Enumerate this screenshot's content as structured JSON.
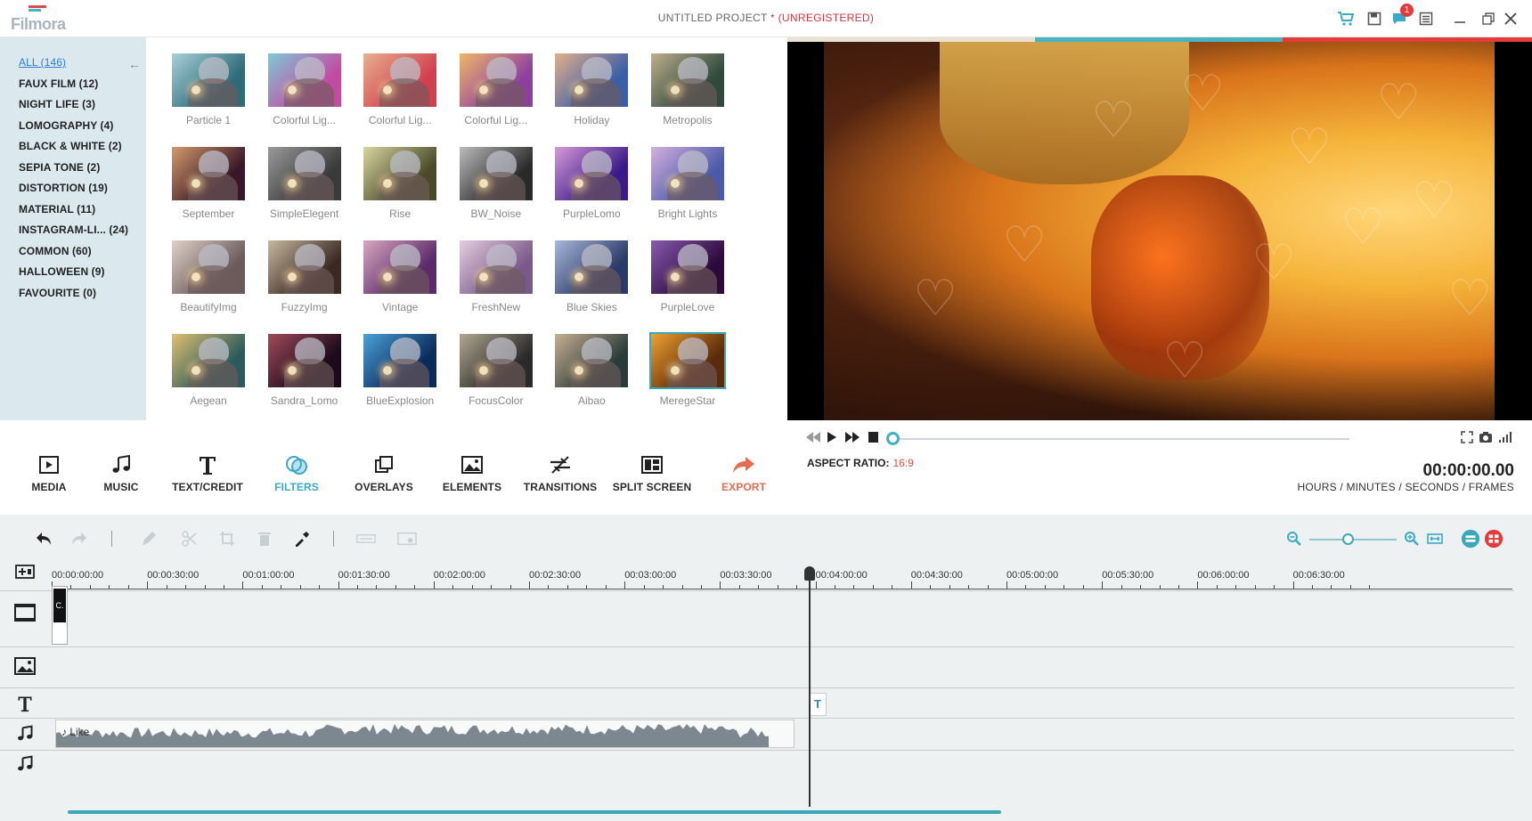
{
  "app": {
    "logo": "Filmora",
    "logo_colors": [
      "#e04b4b",
      "#4ab3c3",
      "#a9b4bd"
    ],
    "title": "UNTITLED PROJECT *",
    "title_status": "(UNREGISTERED)",
    "notifications": "1",
    "icons": [
      "cart-icon",
      "save-icon",
      "chat-icon",
      "menu-icon",
      "minimize-icon",
      "restore-icon",
      "close-icon"
    ]
  },
  "library": {
    "categories": [
      "ALL (146)",
      "FAUX FILM (12)",
      "NIGHT LIFE (3)",
      "LOMOGRAPHY (4)",
      "BLACK & WHITE (2)",
      "SEPIA TONE (2)",
      "DISTORTION (19)",
      "MATERIAL (11)",
      "INSTAGRAM-LI...  (24)",
      "COMMON (60)",
      "HALLOWEEN (9)",
      "FAVOURITE (0)"
    ],
    "active_category": 0,
    "filters": [
      {
        "label": "Particle 1",
        "tint": [
          "#2e6a78",
          "#a7d1d8"
        ]
      },
      {
        "label": "Colorful Lig...",
        "tint": [
          "#c24aa0",
          "#7ec9d8"
        ]
      },
      {
        "label": "Colorful Lig...",
        "tint": [
          "#d23f4f",
          "#e7b08f"
        ]
      },
      {
        "label": "Colorful Lig...",
        "tint": [
          "#8e3f9f",
          "#f0b766"
        ]
      },
      {
        "label": "Holiday",
        "tint": [
          "#3a5ea8",
          "#e3b08a"
        ]
      },
      {
        "label": "Metropolis",
        "tint": [
          "#2f4a3c",
          "#bfae8c"
        ]
      },
      {
        "label": "September",
        "tint": [
          "#3a1628",
          "#d29a6a"
        ]
      },
      {
        "label": "SimpleElegent",
        "tint": [
          "#3a3a3a",
          "#9a9a9a"
        ]
      },
      {
        "label": "Rise",
        "tint": [
          "#4a4a2a",
          "#d8d6a0"
        ]
      },
      {
        "label": "BW_Noise",
        "tint": [
          "#2a2a2a",
          "#bcbcbc"
        ]
      },
      {
        "label": "PurpleLomo",
        "tint": [
          "#3a1a8a",
          "#d79ad8"
        ]
      },
      {
        "label": "Bright Lights",
        "tint": [
          "#4a5aa8",
          "#d5b0e0"
        ]
      },
      {
        "label": "BeautifyImg",
        "tint": [
          "#6a5a5a",
          "#e0d2c8"
        ]
      },
      {
        "label": "FuzzyImg",
        "tint": [
          "#3a2a22",
          "#c8b8a0"
        ]
      },
      {
        "label": "Vintage",
        "tint": [
          "#5a2a6a",
          "#d8a8c0"
        ]
      },
      {
        "label": "FreshNew",
        "tint": [
          "#7a5a8a",
          "#e4cde0"
        ]
      },
      {
        "label": "Blue Skies",
        "tint": [
          "#2a3a6a",
          "#a8b8d8"
        ]
      },
      {
        "label": "PurpleLove",
        "tint": [
          "#2a0a3a",
          "#8a5ab0"
        ]
      },
      {
        "label": "Aegean",
        "tint": [
          "#2a5a5a",
          "#e0c070"
        ]
      },
      {
        "label": "Sandra_Lomo",
        "tint": [
          "#1a0a1a",
          "#a04a5a"
        ]
      },
      {
        "label": "BlueExplosion",
        "tint": [
          "#0a2a5a",
          "#4aa0d8"
        ]
      },
      {
        "label": "FocusColor",
        "tint": [
          "#2a2a2a",
          "#b0a890"
        ]
      },
      {
        "label": "Aibao",
        "tint": [
          "#2a3a3a",
          "#c8b090"
        ]
      },
      {
        "label": "MeregeStar",
        "tint": [
          "#5a2a0a",
          "#f0a030"
        ]
      }
    ],
    "selected_filter": 23
  },
  "tabs": [
    {
      "label": "MEDIA",
      "icon": "media-icon"
    },
    {
      "label": "MUSIC",
      "icon": "music-icon"
    },
    {
      "label": "TEXT/CREDIT",
      "icon": "text-icon"
    },
    {
      "label": "FILTERS",
      "icon": "filters-icon"
    },
    {
      "label": "OVERLAYS",
      "icon": "overlays-icon"
    },
    {
      "label": "ELEMENTS",
      "icon": "elements-icon"
    },
    {
      "label": "TRANSITIONS",
      "icon": "transitions-icon"
    },
    {
      "label": "SPLIT SCREEN",
      "icon": "split-screen-icon"
    },
    {
      "label": "EXPORT",
      "icon": "export-icon"
    }
  ],
  "active_tab": 3,
  "player": {
    "aspect_label": "ASPECT RATIO:",
    "aspect_value": "16:9",
    "timecode": "00:00:00.00",
    "timecode_units": "HOURS / MINUTES / SECONDS / FRAMES",
    "progress": 0
  },
  "timeline": {
    "ruler": [
      "00:00:00:00",
      "00:00:30:00",
      "00:01:00:00",
      "00:01:30:00",
      "00:02:00:00",
      "00:02:30:00",
      "00:03:00:00",
      "00:03:30:00",
      "00:04:00:00",
      "00:04:30:00",
      "00:05:00:00",
      "00:05:30:00",
      "00:06:00:00",
      "00:06:30:00"
    ],
    "video_clip_label": "C.",
    "audio_clip_label": "Like",
    "text_clip_label": "T",
    "playhead_time": "00:03:30:00"
  },
  "colors": {
    "accent": "#3aa9b7",
    "export": "#ea6a4f",
    "unregistered": "#d9333f"
  }
}
